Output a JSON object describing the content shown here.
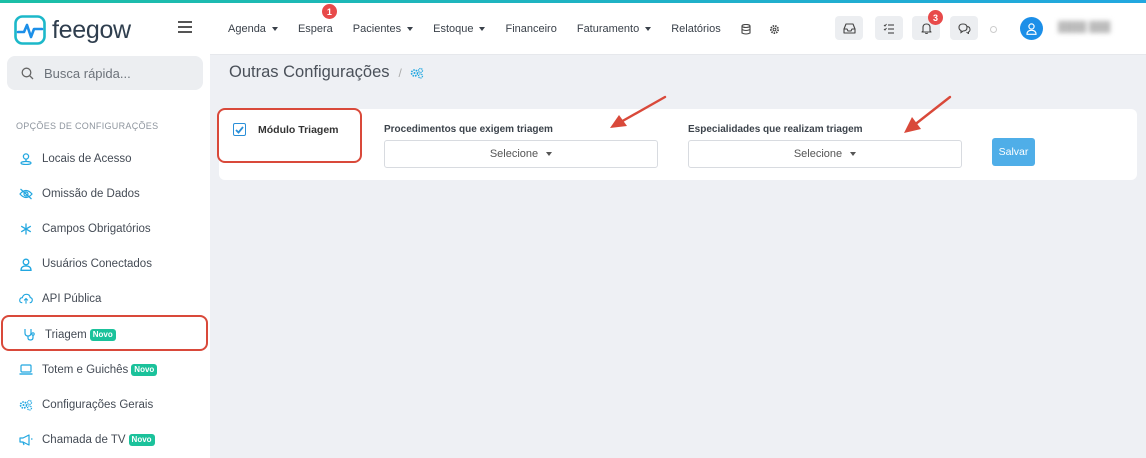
{
  "app": {
    "logo_text": "feegow"
  },
  "search": {
    "placeholder": "Busca rápida..."
  },
  "sidebar": {
    "section_title": "OPÇÕES DE CONFIGURAÇÕES",
    "items": [
      {
        "label": "Locais de Acesso",
        "icon": "location-icon"
      },
      {
        "label": "Omissão de Dados",
        "icon": "eye-off-icon"
      },
      {
        "label": "Campos Obrigatórios",
        "icon": "asterisk-icon"
      },
      {
        "label": "Usuários Conectados",
        "icon": "user-icon"
      },
      {
        "label": "API Pública",
        "icon": "cloud-upload-icon"
      },
      {
        "label": "Triagem",
        "icon": "stethoscope-icon",
        "badge": "Novo"
      },
      {
        "label": "Totem e Guichês",
        "icon": "laptop-icon",
        "badge": "Novo"
      },
      {
        "label": "Configurações Gerais",
        "icon": "gears-icon"
      },
      {
        "label": "Chamada de TV",
        "icon": "megaphone-icon",
        "badge": "Novo"
      }
    ]
  },
  "nav": {
    "items": [
      {
        "label": "Agenda",
        "dropdown": true
      },
      {
        "label": "Espera",
        "badge": "1"
      },
      {
        "label": "Pacientes",
        "dropdown": true
      },
      {
        "label": "Estoque",
        "dropdown": true
      },
      {
        "label": "Financeiro"
      },
      {
        "label": "Faturamento",
        "dropdown": true
      },
      {
        "label": "Relatórios"
      }
    ],
    "notifications_count": "3"
  },
  "main": {
    "title": "Outras Configurações",
    "separator": "/",
    "module_checkbox": {
      "label": "Módulo Triagem",
      "checked": true
    },
    "procedimentos": {
      "label": "Procedimentos que exigem triagem",
      "value": "Selecione"
    },
    "especialidades": {
      "label": "Especialidades que realizam triagem",
      "value": "Selecione"
    },
    "save_label": "Salvar"
  },
  "colors": {
    "accent": "#1c8fe8",
    "badge_new": "#1bc29b",
    "highlight": "#d9493a",
    "save_button": "#4faee8"
  }
}
